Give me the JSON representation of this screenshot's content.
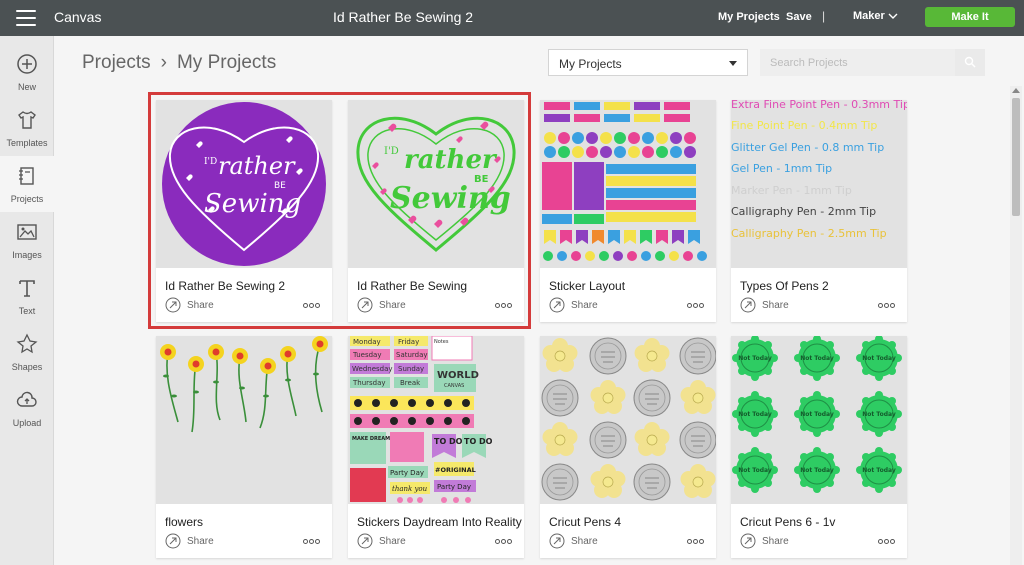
{
  "app": {
    "name": "Canvas",
    "doc_title": "Id Rather Be Sewing 2"
  },
  "toolbar": {
    "my_projects": "My Projects",
    "save": "Save",
    "separator": "|",
    "machine": "Maker",
    "make_it": "Make It"
  },
  "sidebar": {
    "items": [
      {
        "label": "New",
        "icon": "plus-circle-icon"
      },
      {
        "label": "Templates",
        "icon": "shirt-icon"
      },
      {
        "label": "Projects",
        "icon": "notebook-icon"
      },
      {
        "label": "Images",
        "icon": "image-icon"
      },
      {
        "label": "Text",
        "icon": "text-t-icon"
      },
      {
        "label": "Shapes",
        "icon": "shapes-icon"
      },
      {
        "label": "Upload",
        "icon": "cloud-upload-icon"
      }
    ],
    "active": "Projects"
  },
  "header": {
    "breadcrumb": [
      "Projects",
      "My Projects"
    ],
    "filter_selected": "My Projects",
    "search_placeholder": "Search Projects"
  },
  "cards": [
    {
      "name": "Id Rather Be Sewing 2",
      "share": "Share"
    },
    {
      "name": "Id Rather Be Sewing",
      "share": "Share"
    },
    {
      "name": "Sticker Layout",
      "share": "Share"
    },
    {
      "name": "Types Of Pens 2",
      "share": "Share"
    },
    {
      "name": "flowers",
      "share": "Share"
    },
    {
      "name": "Stickers Daydream Into Reality",
      "share": "Share"
    },
    {
      "name": "Cricut Pens 4",
      "share": "Share"
    },
    {
      "name": "Cricut Pens 6 - 1v",
      "share": "Share"
    }
  ],
  "thumbs": {
    "sewing_text": [
      "I'D",
      "rather",
      "BE",
      "Sewing"
    ],
    "pens": [
      {
        "text": "Extra Fine Point Pen - 0.3mm Tip",
        "color": "#e04bb4"
      },
      {
        "text": "Fine Point Pen - 0.4mm Tip",
        "color": "#f2e64a"
      },
      {
        "text": "Glitter Gel Pen - 0.8 mm Tip",
        "color": "#3aa0e0"
      },
      {
        "text": "Gel Pen - 1mm Tip",
        "color": "#3aa0e0"
      },
      {
        "text": "Marker Pen - 1mm Tip",
        "color": "#cfcfcf"
      },
      {
        "text": "Calligraphy Pen - 2mm Tip",
        "color": "#444444"
      },
      {
        "text": "Calligraphy Pen - 2.5mm Tip",
        "color": "#e9c23a"
      }
    ],
    "planner_left": [
      "Monday",
      "Tuesday",
      "Wednesday",
      "Thursday"
    ],
    "planner_right": [
      "Friday",
      "Saturday",
      "Sunday",
      "Break"
    ],
    "planner_notes": "Notes",
    "planner_world": "WORLD",
    "planner_canvas": "CANVAS",
    "planner_todo": "TO DO",
    "planner_make": "MAKE DREAMS HAPPEN",
    "planner_party": "Party Day",
    "planner_original": "#ORIGINAL",
    "planner_thank": "thank you",
    "sticker_not": "Not Today"
  },
  "colors": {
    "topbar": "#4b5153",
    "accent_green": "#58b837",
    "highlight": "#d43b3b",
    "purple": "#8a2bbd",
    "heart_green": "#43c93a",
    "sticker_green": "#2ecc63"
  }
}
